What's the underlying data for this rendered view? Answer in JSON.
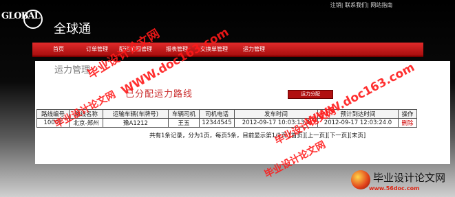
{
  "header": {
    "logo_text": "GLOBAL",
    "site_title": "全球通",
    "top_links": [
      "注销",
      "联系我们",
      "网站指南"
    ]
  },
  "nav": {
    "items": [
      "首页",
      "订单管理",
      "配送范围管理",
      "报表管理",
      "交换单管理",
      "运力管理"
    ]
  },
  "page": {
    "heading": "运力管理",
    "title": "已分配运力路线",
    "allocate_button": "运力分配"
  },
  "table": {
    "headers": [
      "路线编号",
      "路线名称",
      "运输车辆(车牌号)",
      "车辆司机",
      "司机电话",
      "发车时间",
      "预计到达时间",
      "操作"
    ],
    "rows": [
      [
        "10001",
        "北京-郑州",
        "豫A1212",
        "王五",
        "12344545",
        "2012-09-17 10:03:13.0",
        "2012-09-17 12:03:24.0",
        "删除"
      ]
    ]
  },
  "pager": {
    "summary": "共有1条记录，分为1页，每页5条，目前显示第1/1页",
    "links": [
      "[首页]",
      "[上一页]",
      "[下一页]",
      "[末页]"
    ]
  },
  "watermarks": {
    "cn": "毕业设计论文网",
    "url": "WWW.doc163.com"
  },
  "footer_brand": {
    "cn": "毕业设计论文网",
    "url": "www.56doc.com"
  },
  "colors": {
    "nav_red": "#c81818",
    "title_red": "#c92a2a",
    "delete_red": "#d00000"
  }
}
